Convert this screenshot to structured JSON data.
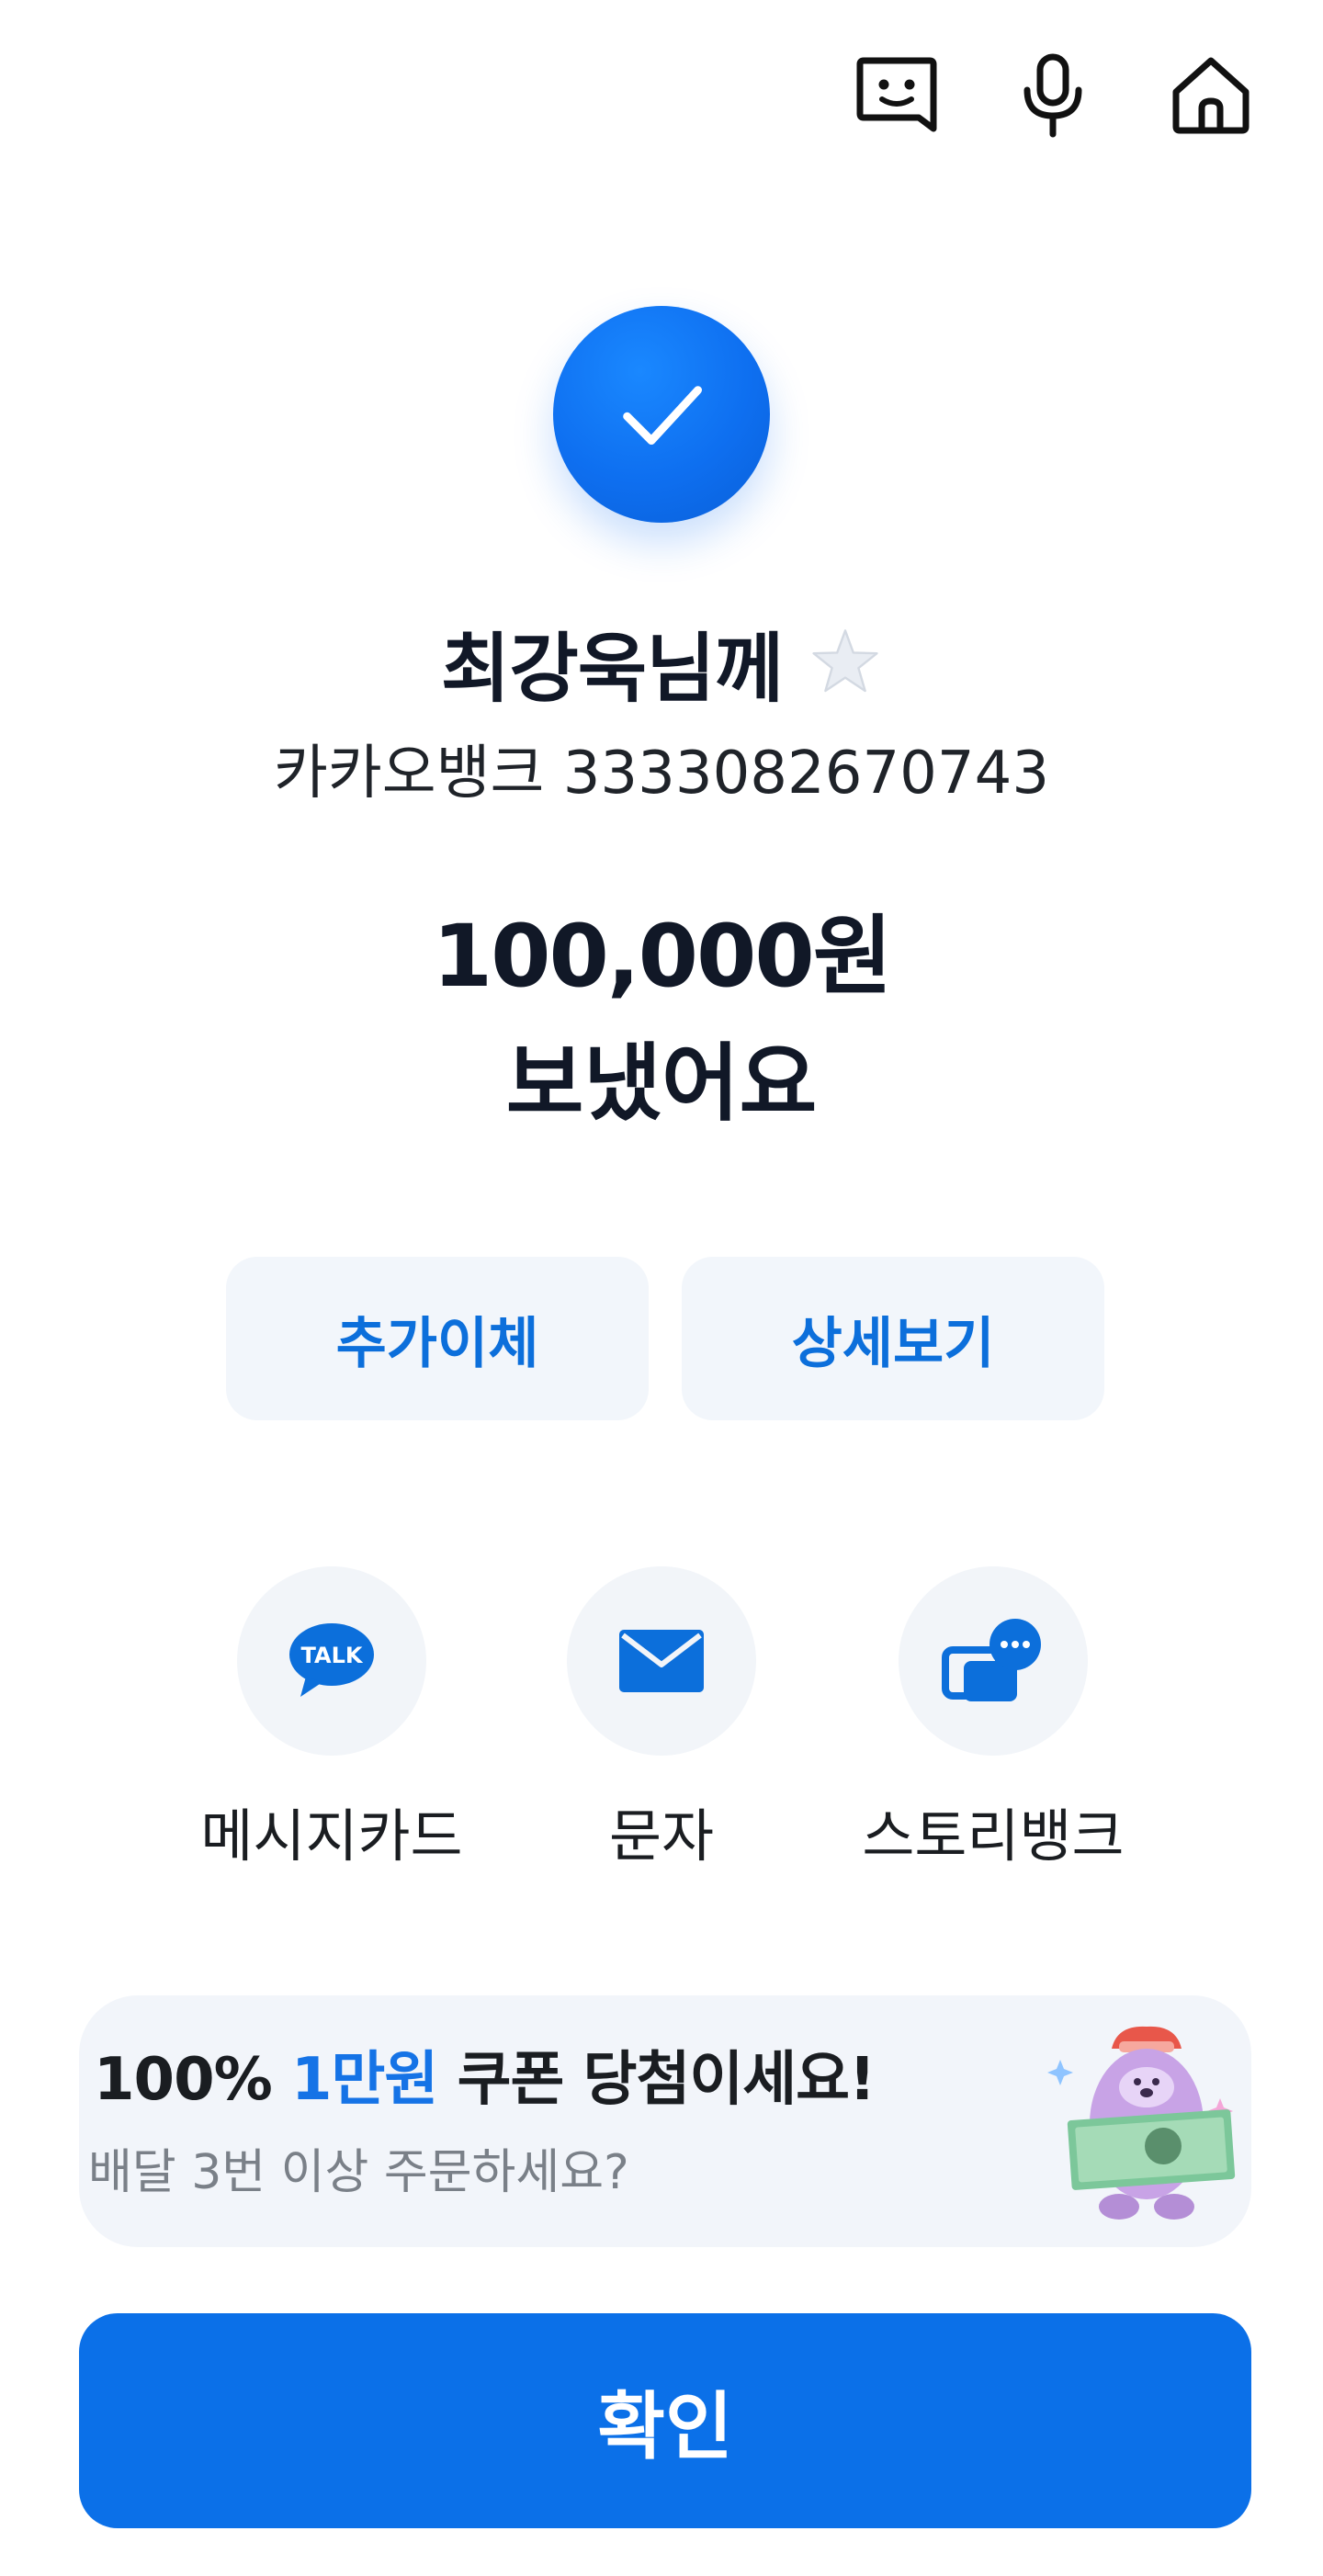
{
  "header": {
    "icons": [
      "chatbot-icon",
      "microphone-icon",
      "home-icon"
    ]
  },
  "status": {
    "icon": "check-icon",
    "color": "#0E6FF0"
  },
  "recipient": {
    "name": "최강욱님께",
    "bank": "카카오뱅크",
    "account_number": "3333082670743"
  },
  "transfer": {
    "amount": "100,000원",
    "message": "보냈어요"
  },
  "actions": {
    "additional_transfer": "추가이체",
    "view_details": "상세보기"
  },
  "share": {
    "items": [
      {
        "label": "메시지카드",
        "icon": "kakaotalk-icon"
      },
      {
        "label": "문자",
        "icon": "envelope-icon"
      },
      {
        "label": "스토리뱅크",
        "icon": "storybank-icon"
      }
    ]
  },
  "banner": {
    "title_prefix": "100%",
    "title_highlight": "1만원",
    "title_suffix": "쿠폰 당첨이세요!",
    "subtitle": "배달 3번 이상 주문하세요?",
    "highlight_color": "#1573E6"
  },
  "confirm": {
    "label": "확인",
    "color": "#0B70E8"
  }
}
